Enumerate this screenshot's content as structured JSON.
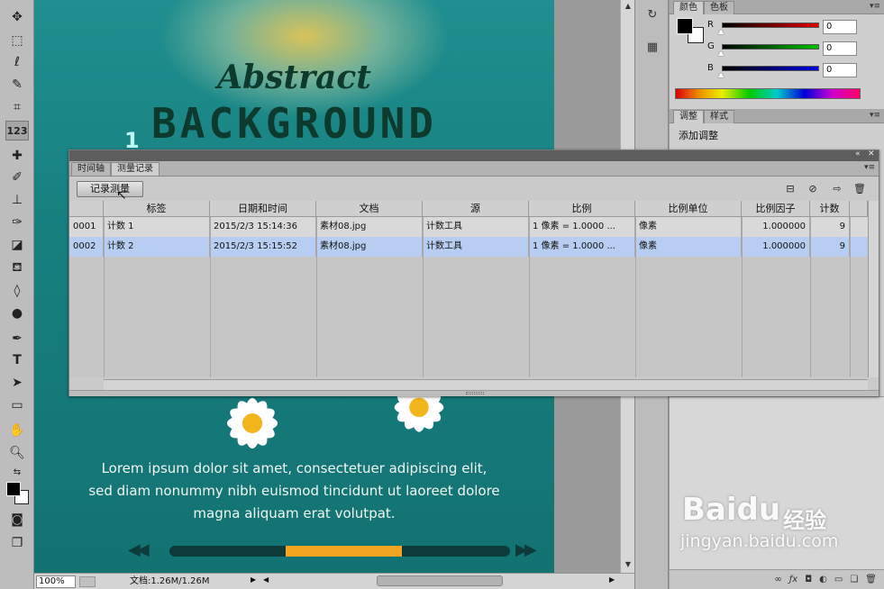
{
  "toolbar": {
    "tools": [
      "move",
      "marquee",
      "lasso",
      "quick-select",
      "crop",
      "count",
      "healing",
      "brush",
      "stamp",
      "history-brush",
      "eraser",
      "paint-bucket",
      "blur",
      "dodge",
      "pen",
      "type",
      "path-select",
      "shape",
      "hand",
      "zoom"
    ],
    "count_label": "123",
    "type_label": "T",
    "foreground": "#000000",
    "background": "#ffffff"
  },
  "artwork": {
    "title_script": "Abstract",
    "title_main": "BACKGROUND",
    "number": "1",
    "lorem": [
      "Lorem ipsum dolor sit amet, consectetuer adipiscing elit,",
      "sed diam nonummy nibh euismod tincidunt ut laoreet dolore",
      "magna aliquam erat volutpat."
    ],
    "progress_fraction": 0.34,
    "progress_color": "#f3a521"
  },
  "statusbar": {
    "zoom": "100%",
    "doc_info": "文档:1.26M/1.26M"
  },
  "color_panel": {
    "tabs": [
      "颜色",
      "色板"
    ],
    "channels": [
      {
        "label": "R",
        "value": "0",
        "color": "#d00000"
      },
      {
        "label": "G",
        "value": "0",
        "color": "#00b000"
      },
      {
        "label": "B",
        "value": "0",
        "color": "#0000d0"
      }
    ]
  },
  "adjust_panel": {
    "tabs": [
      "调整",
      "样式"
    ],
    "title": "添加调整"
  },
  "measure_panel": {
    "tabs": [
      "时间轴",
      "测量记录"
    ],
    "record_button": "记录测量",
    "columns": [
      "标签",
      "日期和时间",
      "文档",
      "源",
      "比例",
      "比例单位",
      "比例因子",
      "计数"
    ],
    "rows": [
      {
        "id": "0001",
        "label": "计数 1",
        "datetime": "2015/2/3 15:14:36",
        "doc": "素材08.jpg",
        "source": "计数工具",
        "scale": "1 像素 = 1.0000 ...",
        "unit": "像素",
        "factor": "1.000000",
        "count": "9"
      },
      {
        "id": "0002",
        "label": "计数 2",
        "datetime": "2015/2/3 15:15:52",
        "doc": "素材08.jpg",
        "source": "计数工具",
        "scale": "1 像素 = 1.0000 ...",
        "unit": "像素",
        "factor": "1.000000",
        "count": "9"
      }
    ]
  },
  "watermark": {
    "brand": "Baidu",
    "brand_cn": "经验",
    "url": "jingyan.baidu.com"
  }
}
